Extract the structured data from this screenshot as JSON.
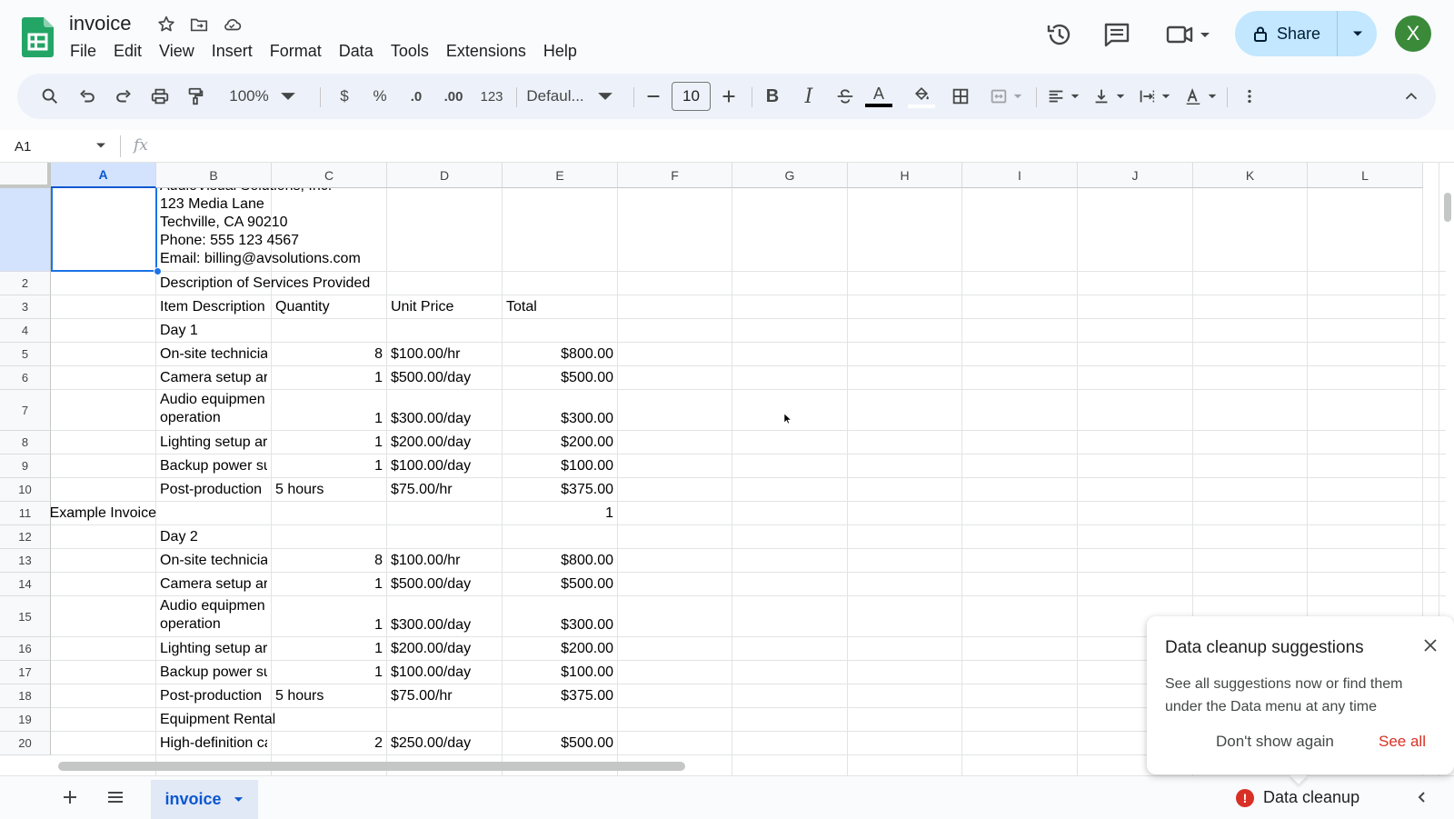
{
  "app": {
    "doc_title": "invoice",
    "menu": [
      "File",
      "Edit",
      "View",
      "Insert",
      "Format",
      "Data",
      "Tools",
      "Extensions",
      "Help"
    ],
    "share_label": "Share",
    "avatar_letter": "X"
  },
  "toolbar": {
    "zoom": "100%",
    "currency": "$",
    "percent": "%",
    "dec_decrease": ".0",
    "dec_increase": ".00",
    "format_number": "123",
    "font": "Defaul...",
    "font_size": "10"
  },
  "formula_bar": {
    "name_box": "A1",
    "fx": "fx"
  },
  "grid": {
    "columns": [
      "A",
      "B",
      "C",
      "D",
      "E",
      "F",
      "G",
      "H",
      "I",
      "J",
      "K",
      "L"
    ],
    "selected_column": "A",
    "rows": [
      {
        "num": "",
        "b_lines": [
          "AudioVisual Solutions, Inc.",
          "123 Media Lane",
          "Techville, CA 90210",
          "Phone: 555 123 4567",
          "Email: billing@avsolutions.com"
        ]
      },
      {
        "num": "2",
        "b": "Description of Services Provided"
      },
      {
        "num": "3",
        "b": "Item Description",
        "c": "Quantity",
        "d": "Unit Price",
        "e": "Total"
      },
      {
        "num": "4",
        "b": "Day 1"
      },
      {
        "num": "5",
        "b": "On-site technicia",
        "c": "8",
        "d": "$100.00/hr",
        "e": "$800.00"
      },
      {
        "num": "6",
        "b": "Camera setup ar",
        "c": "1",
        "d": "$500.00/day",
        "e": "$500.00"
      },
      {
        "num": "7",
        "b_lines": [
          "Audio equipmen",
          "operation"
        ],
        "c": "1",
        "d": "$300.00/day",
        "e": "$300.00"
      },
      {
        "num": "8",
        "b": "Lighting setup ar",
        "c": "1",
        "d": "$200.00/day",
        "e": "$200.00"
      },
      {
        "num": "9",
        "b": "Backup power su",
        "c": "1",
        "d": "$100.00/day",
        "e": "$100.00"
      },
      {
        "num": "10",
        "b": "Post-production",
        "c": "5 hours",
        "d": "$75.00/hr",
        "e": "$375.00"
      },
      {
        "num": "11",
        "a": "Example Invoice",
        "e": "1"
      },
      {
        "num": "12",
        "b": "Day 2"
      },
      {
        "num": "13",
        "b": "On-site technicia",
        "c": "8",
        "d": "$100.00/hr",
        "e": "$800.00"
      },
      {
        "num": "14",
        "b": "Camera setup ar",
        "c": "1",
        "d": "$500.00/day",
        "e": "$500.00"
      },
      {
        "num": "15",
        "b_lines": [
          "Audio equipmen",
          "operation"
        ],
        "c": "1",
        "d": "$300.00/day",
        "e": "$300.00"
      },
      {
        "num": "16",
        "b": "Lighting setup ar",
        "c": "1",
        "d": "$200.00/day",
        "e": "$200.00"
      },
      {
        "num": "17",
        "b": "Backup power su",
        "c": "1",
        "d": "$100.00/day",
        "e": "$100.00"
      },
      {
        "num": "18",
        "b": "Post-production",
        "c": "5 hours",
        "d": "$75.00/hr",
        "e": "$375.00"
      },
      {
        "num": "19",
        "b": "Equipment Rental"
      },
      {
        "num": "20",
        "b": "High-definition ca",
        "c": "2",
        "d": "$250.00/day",
        "e": "$500.00"
      }
    ]
  },
  "sheets": {
    "active": "invoice"
  },
  "cleanup": {
    "label": "Data cleanup",
    "badge": "!"
  },
  "popup": {
    "title": "Data cleanup suggestions",
    "body": "See all suggestions now or find them under the Data menu at any time",
    "dont_show": "Don't show again",
    "see_all": "See all"
  },
  "colors": {
    "accent": "#0b57d0",
    "share_bg": "#c2e7ff",
    "toolbar_bg": "#edf2fa",
    "avatar": "#3a8a3a",
    "warning": "#d93025"
  }
}
